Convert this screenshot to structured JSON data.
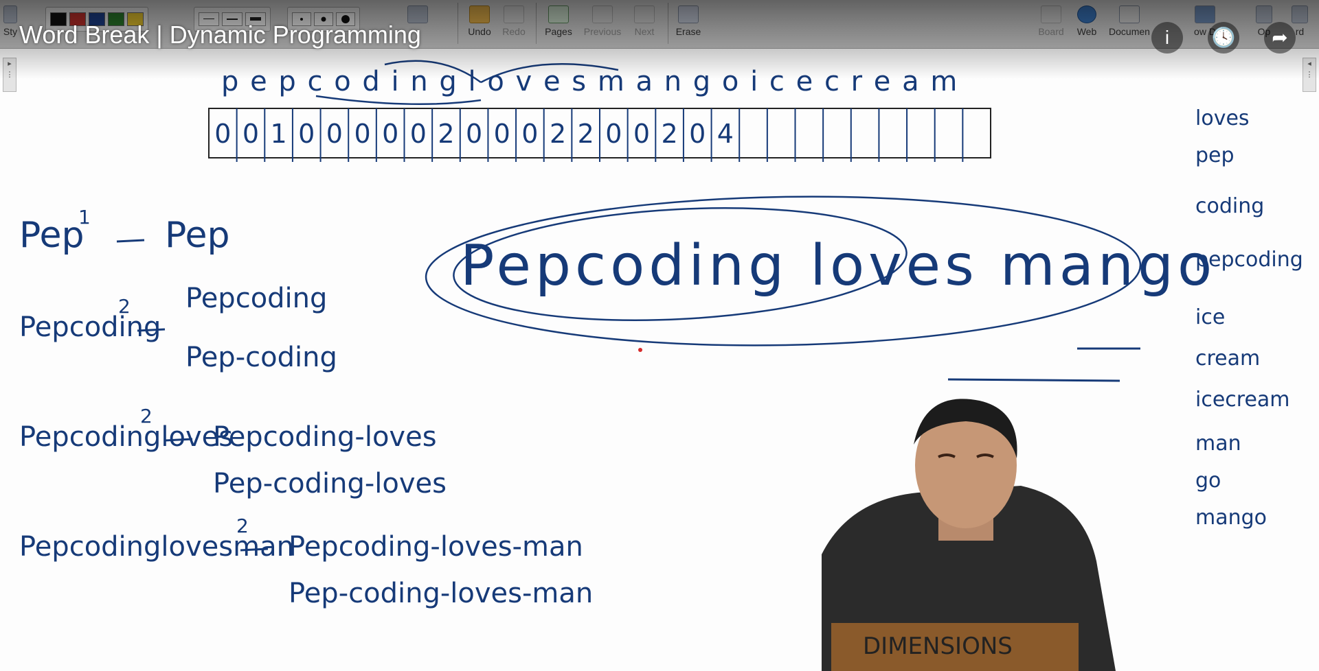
{
  "video_title": "Word Break | Dynamic Programming",
  "overlay_buttons": [
    {
      "icon": "info-icon",
      "glyph": "i"
    },
    {
      "icon": "watch-later-icon",
      "glyph": "🕓"
    },
    {
      "icon": "share-icon",
      "glyph": "➦"
    }
  ],
  "toolbar": {
    "style_label": "Sty",
    "undo_label": "Undo",
    "redo_label": "Redo",
    "pages_label": "Pages",
    "previous_label": "Previous",
    "next_label": "Next",
    "erase_label": "Erase",
    "board_label": "Board",
    "web_label": "Web",
    "document_label": "Documen",
    "show_label": "ow D",
    "open_label": "Op",
    "word_label": "rd",
    "pen_colors": [
      "#111111",
      "#c0302b",
      "#1d3f8a",
      "#2a7a2a",
      "#e6c42d"
    ]
  },
  "board": {
    "top_string": "p e p c o d i n g l o v e s m a n g o i c e c r e a m",
    "dp_values": [
      "0",
      "0",
      "1",
      "0",
      "0",
      "0",
      "0",
      "0",
      "2",
      "0",
      "0",
      "0",
      "2",
      "2",
      "0",
      "0",
      "2",
      "0",
      "4",
      "",
      "",
      "",
      "",
      "",
      "",
      "",
      "",
      ""
    ],
    "dictionary": [
      "loves",
      "pep",
      "coding",
      "pepcoding",
      "ice",
      "cream",
      "icecream",
      "man",
      "go",
      "mango"
    ],
    "sentence": "Pepcoding loves mango",
    "left_notes": [
      {
        "lhs": "Pep",
        "count": "1",
        "rhs": [
          "Pep"
        ]
      },
      {
        "lhs": "Pepcoding",
        "count": "2",
        "rhs": [
          "Pepcoding",
          "Pep-coding"
        ]
      },
      {
        "lhs": "Pepcodingloves",
        "count": "2",
        "rhs": [
          "Pepcoding-loves",
          "Pep-coding-loves"
        ]
      },
      {
        "lhs": "Pepcodinglovesman",
        "count": "2",
        "rhs": [
          "Pepcoding-loves-man",
          "Pep-coding-loves-man"
        ]
      }
    ]
  }
}
